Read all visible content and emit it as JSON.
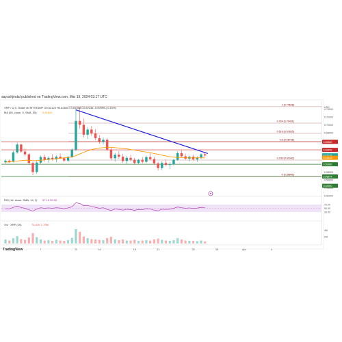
{
  "attribution": "aayushjindal published on TradingView.com, Mar 19, 2024 03:17 UTC",
  "branding": "TradingView",
  "header": {
    "symbol_line": "XRP / U.S. Dollar  4h  BITSTAMP  O0.62125  H0.62820  L0.61968  C0.62236  -0.00096 (-0.15%)",
    "ma_line": "MA (55, close, 0, SMA, 55)",
    "ma_value": "0.61643",
    "rsi_line": "RSI (14, close, SMA, 14, 2)",
    "rsi_values": "57.15  55.55",
    "vol_line": "Vol · XRP (20)",
    "vol_values": "75.41K  1.79M"
  },
  "colors": {
    "candle_up": "#26a69a",
    "candle_down": "#ef5350",
    "trendline": "#1a1ae0",
    "ma": "#ff9800",
    "fib": "#7a0000",
    "support": "#2e7d32",
    "resistance": "#c62828",
    "rsi": "#b040b0",
    "rsi_band": "#e9d7f5"
  },
  "chart_data": {
    "type": "candlestick",
    "x_tick_labels": [
      "4",
      "7",
      "11",
      "14",
      "18",
      "21",
      "25",
      "28",
      "Apr",
      "4"
    ],
    "y_tick_labels": [
      "USD",
      "0.74000",
      "0.72000",
      "0.70000",
      "0.68000",
      "0.66000",
      "0.64000",
      "0.62000",
      "0.60000",
      "0.58000",
      "0.56000",
      "0.54000",
      "0.52000",
      "0.50000"
    ],
    "candles": [
      {
        "o": 0.605,
        "h": 0.613,
        "l": 0.6,
        "c": 0.609
      },
      {
        "o": 0.609,
        "h": 0.612,
        "l": 0.603,
        "c": 0.606
      },
      {
        "o": 0.606,
        "h": 0.634,
        "l": 0.604,
        "c": 0.63
      },
      {
        "o": 0.63,
        "h": 0.655,
        "l": 0.626,
        "c": 0.65
      },
      {
        "o": 0.65,
        "h": 0.652,
        "l": 0.628,
        "c": 0.632
      },
      {
        "o": 0.632,
        "h": 0.64,
        "l": 0.62,
        "c": 0.625
      },
      {
        "o": 0.625,
        "h": 0.628,
        "l": 0.598,
        "c": 0.603
      },
      {
        "o": 0.603,
        "h": 0.606,
        "l": 0.572,
        "c": 0.58
      },
      {
        "o": 0.58,
        "h": 0.61,
        "l": 0.576,
        "c": 0.604
      },
      {
        "o": 0.604,
        "h": 0.622,
        "l": 0.6,
        "c": 0.618
      },
      {
        "o": 0.618,
        "h": 0.624,
        "l": 0.606,
        "c": 0.611
      },
      {
        "o": 0.611,
        "h": 0.62,
        "l": 0.603,
        "c": 0.616
      },
      {
        "o": 0.616,
        "h": 0.625,
        "l": 0.609,
        "c": 0.612
      },
      {
        "o": 0.612,
        "h": 0.622,
        "l": 0.605,
        "c": 0.619
      },
      {
        "o": 0.619,
        "h": 0.627,
        "l": 0.613,
        "c": 0.615
      },
      {
        "o": 0.615,
        "h": 0.618,
        "l": 0.605,
        "c": 0.609
      },
      {
        "o": 0.609,
        "h": 0.621,
        "l": 0.606,
        "c": 0.618
      },
      {
        "o": 0.618,
        "h": 0.64,
        "l": 0.616,
        "c": 0.637
      },
      {
        "o": 0.637,
        "h": 0.74,
        "l": 0.633,
        "c": 0.71
      },
      {
        "o": 0.71,
        "h": 0.744,
        "l": 0.69,
        "c": 0.7
      },
      {
        "o": 0.7,
        "h": 0.716,
        "l": 0.668,
        "c": 0.675
      },
      {
        "o": 0.675,
        "h": 0.694,
        "l": 0.664,
        "c": 0.688
      },
      {
        "o": 0.688,
        "h": 0.697,
        "l": 0.672,
        "c": 0.678
      },
      {
        "o": 0.678,
        "h": 0.689,
        "l": 0.661,
        "c": 0.666
      },
      {
        "o": 0.666,
        "h": 0.674,
        "l": 0.652,
        "c": 0.657
      },
      {
        "o": 0.657,
        "h": 0.668,
        "l": 0.65,
        "c": 0.662
      },
      {
        "o": 0.662,
        "h": 0.666,
        "l": 0.633,
        "c": 0.637
      },
      {
        "o": 0.637,
        "h": 0.642,
        "l": 0.61,
        "c": 0.615
      },
      {
        "o": 0.615,
        "h": 0.629,
        "l": 0.606,
        "c": 0.624
      },
      {
        "o": 0.624,
        "h": 0.633,
        "l": 0.614,
        "c": 0.619
      },
      {
        "o": 0.619,
        "h": 0.626,
        "l": 0.603,
        "c": 0.608
      },
      {
        "o": 0.608,
        "h": 0.621,
        "l": 0.6,
        "c": 0.616
      },
      {
        "o": 0.616,
        "h": 0.624,
        "l": 0.607,
        "c": 0.611
      },
      {
        "o": 0.611,
        "h": 0.616,
        "l": 0.598,
        "c": 0.603
      },
      {
        "o": 0.603,
        "h": 0.614,
        "l": 0.599,
        "c": 0.611
      },
      {
        "o": 0.611,
        "h": 0.618,
        "l": 0.602,
        "c": 0.606
      },
      {
        "o": 0.606,
        "h": 0.622,
        "l": 0.603,
        "c": 0.618
      },
      {
        "o": 0.618,
        "h": 0.628,
        "l": 0.61,
        "c": 0.613
      },
      {
        "o": 0.613,
        "h": 0.619,
        "l": 0.598,
        "c": 0.602
      },
      {
        "o": 0.602,
        "h": 0.606,
        "l": 0.584,
        "c": 0.59
      },
      {
        "o": 0.59,
        "h": 0.608,
        "l": 0.585,
        "c": 0.603
      },
      {
        "o": 0.603,
        "h": 0.612,
        "l": 0.596,
        "c": 0.598
      },
      {
        "o": 0.598,
        "h": 0.605,
        "l": 0.588,
        "c": 0.6
      },
      {
        "o": 0.6,
        "h": 0.614,
        "l": 0.597,
        "c": 0.611
      },
      {
        "o": 0.611,
        "h": 0.633,
        "l": 0.609,
        "c": 0.628
      },
      {
        "o": 0.628,
        "h": 0.635,
        "l": 0.616,
        "c": 0.62
      },
      {
        "o": 0.62,
        "h": 0.627,
        "l": 0.611,
        "c": 0.614
      },
      {
        "o": 0.614,
        "h": 0.622,
        "l": 0.607,
        "c": 0.619
      },
      {
        "o": 0.619,
        "h": 0.624,
        "l": 0.609,
        "c": 0.612
      },
      {
        "o": 0.612,
        "h": 0.62,
        "l": 0.606,
        "c": 0.617
      },
      {
        "o": 0.617,
        "h": 0.628,
        "l": 0.613,
        "c": 0.625
      },
      {
        "o": 0.625,
        "h": 0.631,
        "l": 0.619,
        "c": 0.622
      }
    ],
    "ma": [
      0.605,
      0.606,
      0.607,
      0.608,
      0.609,
      0.61,
      0.61,
      0.609,
      0.609,
      0.61,
      0.611,
      0.612,
      0.613,
      0.614,
      0.615,
      0.616,
      0.617,
      0.618,
      0.622,
      0.626,
      0.63,
      0.634,
      0.637,
      0.639,
      0.641,
      0.642,
      0.643,
      0.643,
      0.642,
      0.641,
      0.64,
      0.639,
      0.637,
      0.636,
      0.634,
      0.632,
      0.631,
      0.629,
      0.627,
      0.625,
      0.623,
      0.621,
      0.619,
      0.618,
      0.617,
      0.617,
      0.616,
      0.616,
      0.616,
      0.616,
      0.616,
      0.616
    ],
    "trendline": {
      "from_index": 18,
      "from_value": 0.738,
      "to_index": 51,
      "to_value": 0.627
    },
    "fib_levels": [
      {
        "ratio": "1",
        "label": "1 (0.74628)",
        "value": 0.74628
      },
      {
        "ratio": "0.764",
        "label": "0.764 (0.70431)",
        "value": 0.70431
      },
      {
        "ratio": "0.618",
        "label": "0.618 (0.67835)",
        "value": 0.67835
      },
      {
        "ratio": "0.5",
        "label": "0.5 (0.65736)",
        "value": 0.65736
      },
      {
        "ratio": "0.236",
        "label": "0.236 (0.61042)",
        "value": 0.61042
      },
      {
        "ratio": "0",
        "label": "0 (0.56845)",
        "value": 0.56845
      }
    ],
    "horizontal_lines": [
      {
        "kind": "resistance",
        "value": 0.6568,
        "label": "0.65680"
      },
      {
        "kind": "resistance",
        "value": 0.6364,
        "label": "0.63632"
      },
      {
        "kind": "support",
        "value": 0.5998,
        "label": "0.59983"
      },
      {
        "kind": "support",
        "value": 0.5687,
        "label": "0.56874"
      }
    ],
    "price_tags": [
      {
        "value": 0.6224,
        "label": "0.62236",
        "color": "#26a69a"
      },
      {
        "value": 0.6164,
        "label": "0.61643",
        "color": "#ff9800"
      },
      {
        "value": 0.545,
        "label": "0.54500",
        "color": "#2e7d32"
      }
    ],
    "rsi": {
      "range": [
        0,
        100
      ],
      "band": [
        30,
        70
      ],
      "ticks": [
        "70.00",
        "50.00",
        "30.00"
      ],
      "values": [
        48,
        47,
        55,
        62,
        54,
        50,
        42,
        35,
        46,
        53,
        50,
        52,
        50,
        53,
        51,
        48,
        52,
        58,
        80,
        76,
        64,
        66,
        60,
        55,
        50,
        53,
        44,
        38,
        46,
        44,
        40,
        45,
        43,
        39,
        44,
        42,
        48,
        46,
        40,
        36,
        45,
        44,
        45,
        50,
        57,
        53,
        50,
        52,
        49,
        51,
        55,
        54
      ]
    },
    "volume": {
      "ticks": [
        "4M",
        "2M"
      ],
      "values": [
        1.2,
        0.9,
        1.6,
        2.2,
        1.3,
        1.1,
        1.8,
        3.1,
        1.9,
        1.2,
        0.9,
        1.0,
        0.8,
        1.1,
        0.9,
        0.8,
        1.0,
        1.7,
        4.3,
        3.5,
        2.1,
        1.6,
        1.3,
        1.2,
        1.1,
        1.0,
        1.6,
        2.0,
        1.2,
        1.0,
        1.2,
        0.9,
        0.9,
        1.1,
        0.8,
        0.9,
        1.0,
        0.9,
        1.2,
        1.5,
        1.1,
        0.9,
        0.8,
        1.0,
        1.6,
        1.2,
        0.9,
        0.8,
        0.8,
        0.7,
        0.9,
        0.6
      ]
    },
    "price_ylim": [
      0.52,
      0.76
    ]
  }
}
